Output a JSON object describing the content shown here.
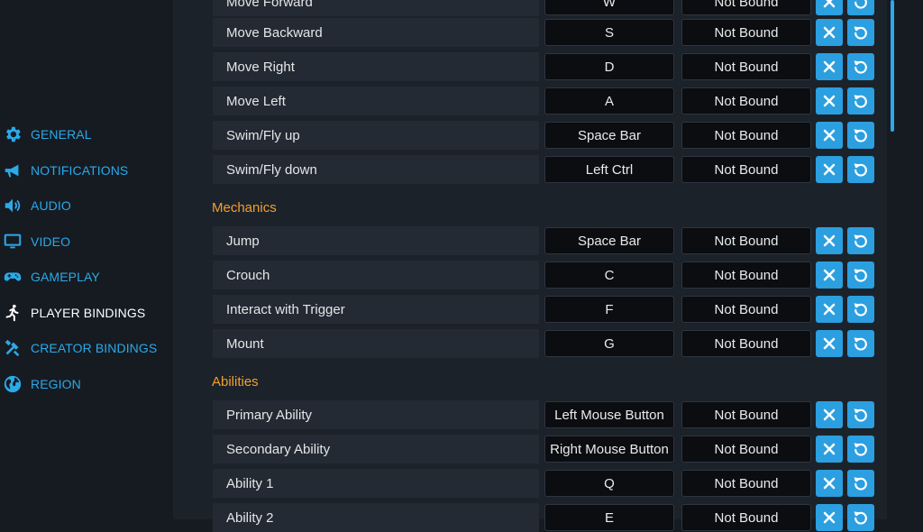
{
  "sidebar": {
    "items": [
      {
        "label": "GENERAL",
        "icon": "gear-icon",
        "active": false
      },
      {
        "label": "NOTIFICATIONS",
        "icon": "megaphone-icon",
        "active": false
      },
      {
        "label": "AUDIO",
        "icon": "speaker-icon",
        "active": false
      },
      {
        "label": "VIDEO",
        "icon": "monitor-icon",
        "active": false
      },
      {
        "label": "GAMEPLAY",
        "icon": "gamepad-icon",
        "active": false
      },
      {
        "label": "PLAYER BINDINGS",
        "icon": "running-person-icon",
        "active": true
      },
      {
        "label": "CREATOR BINDINGS",
        "icon": "tools-icon",
        "active": false
      },
      {
        "label": "REGION",
        "icon": "globe-icon",
        "active": false
      }
    ]
  },
  "bindings": {
    "movement": [
      {
        "action": "Move Forward",
        "primary": "W",
        "secondary": "Not Bound"
      },
      {
        "action": "Move Backward",
        "primary": "S",
        "secondary": "Not Bound"
      },
      {
        "action": "Move Right",
        "primary": "D",
        "secondary": "Not Bound"
      },
      {
        "action": "Move Left",
        "primary": "A",
        "secondary": "Not Bound"
      },
      {
        "action": "Swim/Fly up",
        "primary": "Space Bar",
        "secondary": "Not Bound"
      },
      {
        "action": "Swim/Fly down",
        "primary": "Left Ctrl",
        "secondary": "Not Bound"
      }
    ],
    "mechanics_title": "Mechanics",
    "mechanics": [
      {
        "action": "Jump",
        "primary": "Space Bar",
        "secondary": "Not Bound"
      },
      {
        "action": "Crouch",
        "primary": "C",
        "secondary": "Not Bound"
      },
      {
        "action": "Interact with Trigger",
        "primary": "F",
        "secondary": "Not Bound"
      },
      {
        "action": "Mount",
        "primary": "G",
        "secondary": "Not Bound"
      }
    ],
    "abilities_title": "Abilities",
    "abilities": [
      {
        "action": "Primary Ability",
        "primary": "Left Mouse Button",
        "secondary": "Not Bound"
      },
      {
        "action": "Secondary Ability",
        "primary": "Right Mouse Button",
        "secondary": "Not Bound"
      },
      {
        "action": "Ability 1",
        "primary": "Q",
        "secondary": "Not Bound"
      },
      {
        "action": "Ability 2",
        "primary": "E",
        "secondary": "Not Bound"
      }
    ]
  },
  "colors": {
    "accent": "#2ba9e8",
    "section_title": "#f0a030",
    "button": "#2b9fe0"
  }
}
